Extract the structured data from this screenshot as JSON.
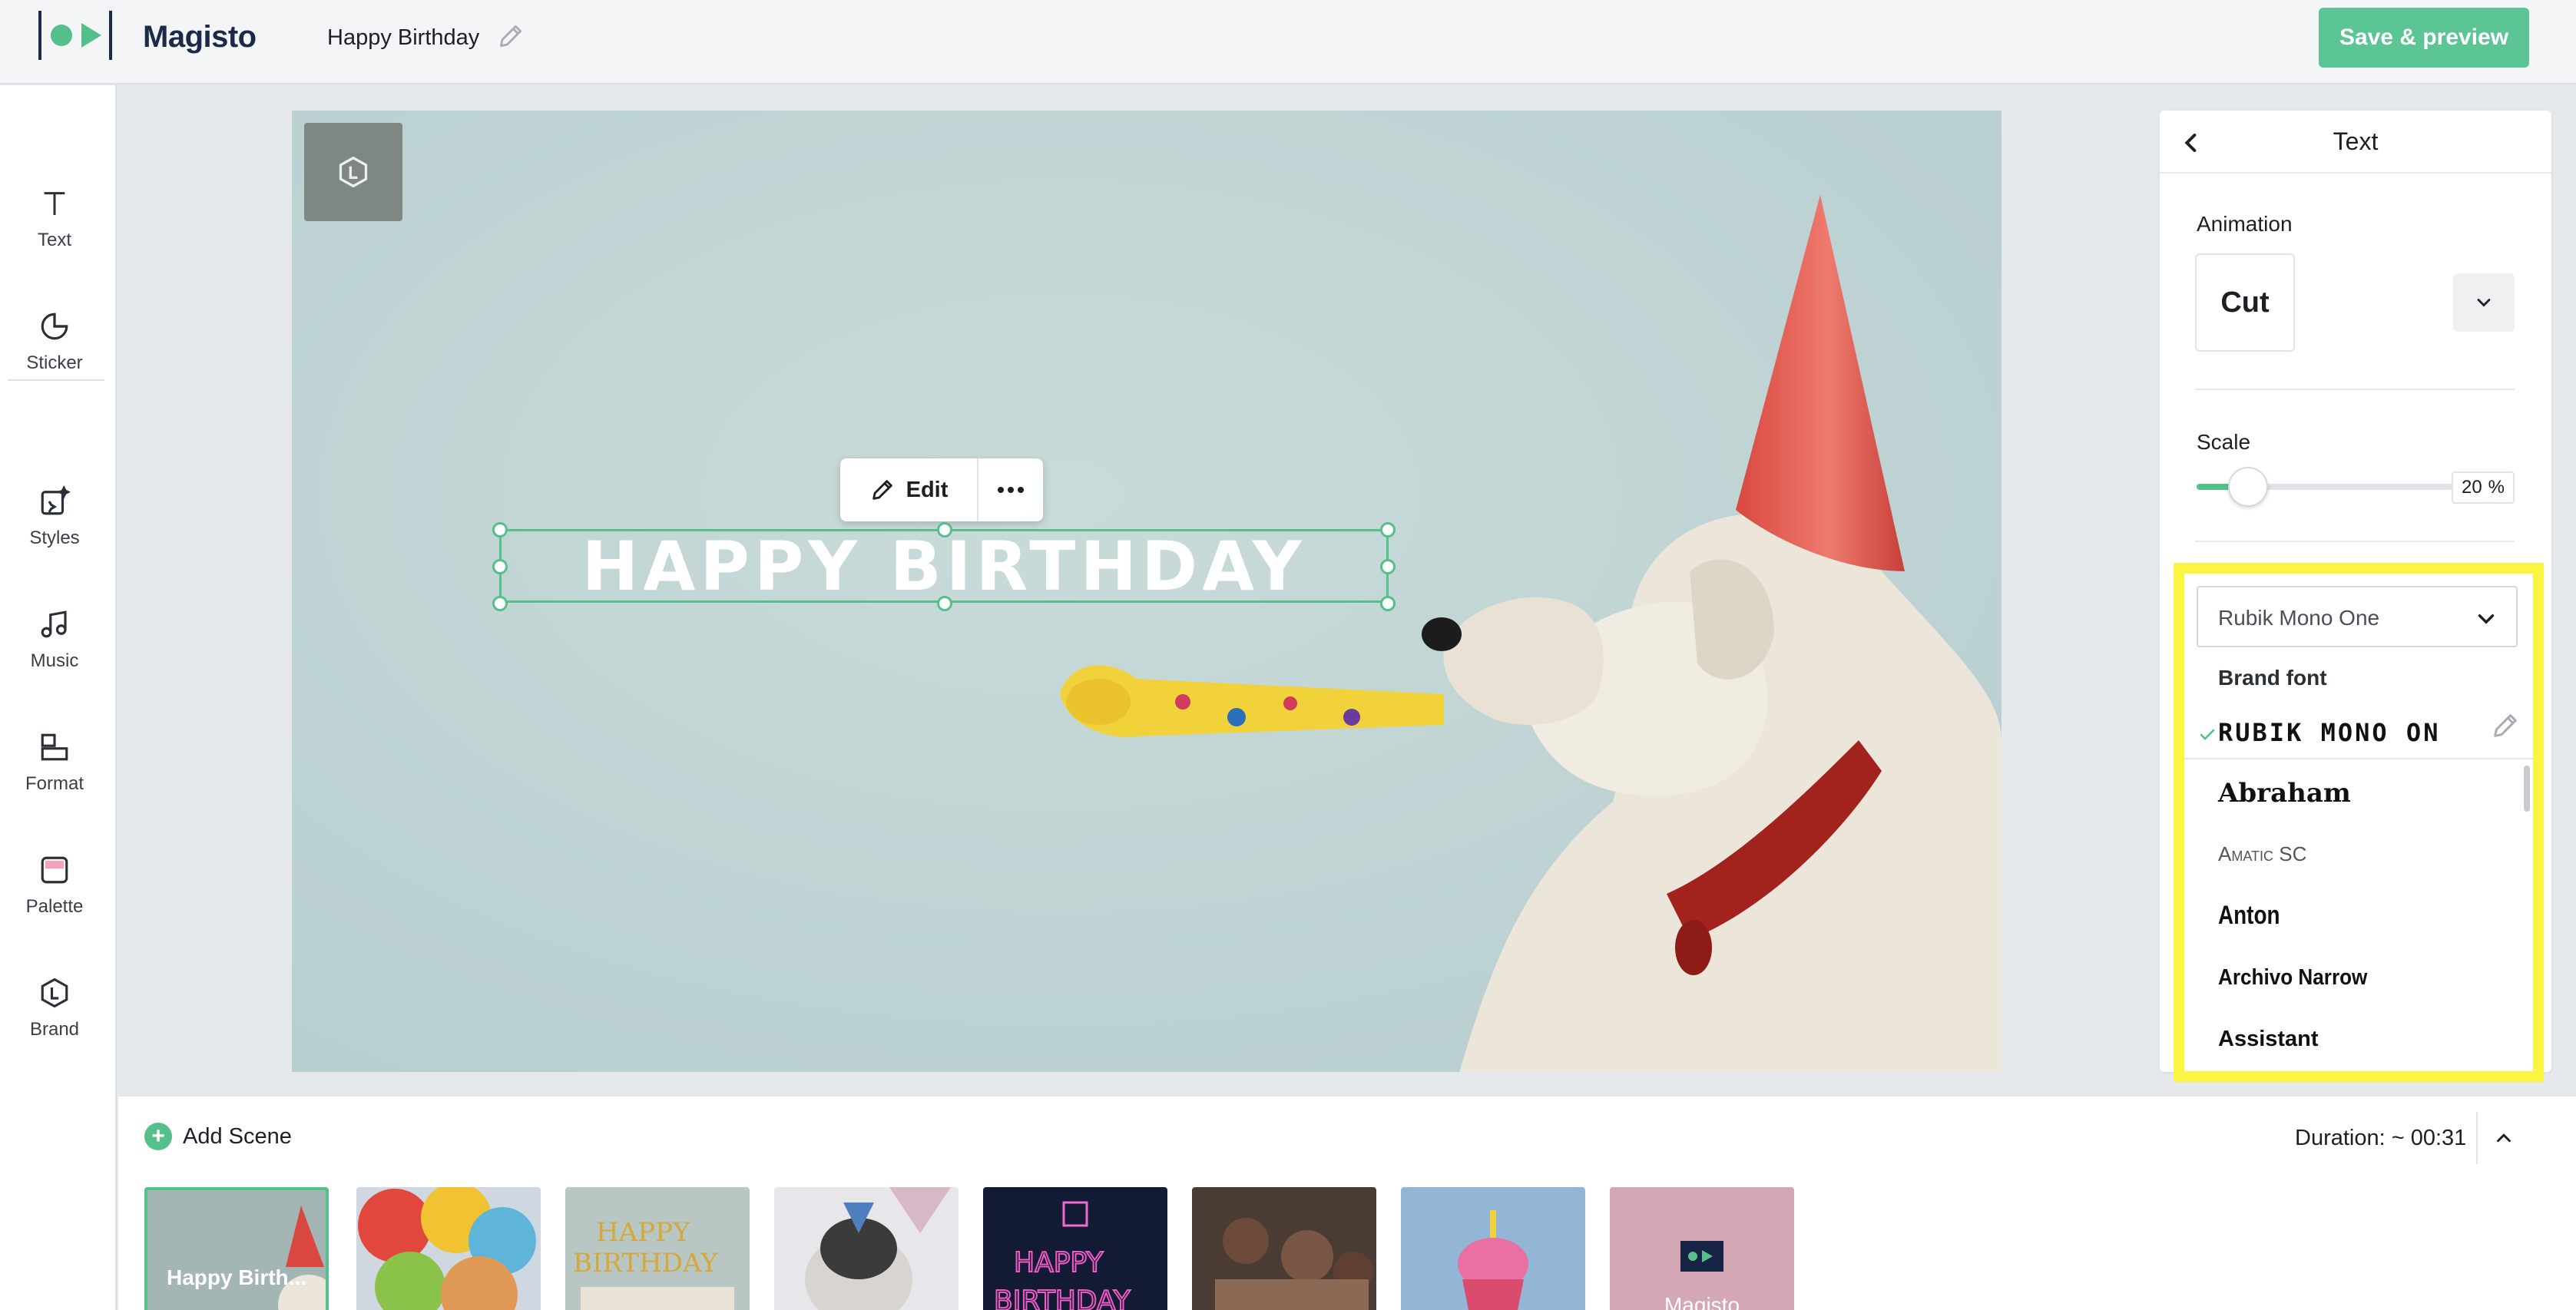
{
  "app": {
    "brand": "Magisto",
    "project_title": "Happy Birthday",
    "save_button": "Save & preview"
  },
  "toolbar": {
    "items": [
      {
        "label": "Text",
        "icon": "text-icon"
      },
      {
        "label": "Sticker",
        "icon": "sticker-icon"
      },
      {
        "label": "Styles",
        "icon": "styles-icon"
      },
      {
        "label": "Music",
        "icon": "music-icon"
      },
      {
        "label": "Format",
        "icon": "format-icon"
      },
      {
        "label": "Palette",
        "icon": "palette-icon"
      },
      {
        "label": "Brand",
        "icon": "brand-icon"
      }
    ]
  },
  "canvas": {
    "headline": "HAPPY BIRTHDAY",
    "edit_label": "Edit"
  },
  "panel": {
    "title": "Text",
    "animation_label": "Animation",
    "animation_value": "Cut",
    "scale_label": "Scale",
    "scale_value": "20",
    "scale_unit": "%",
    "scale_fraction": 0.2,
    "font_selected": "Rubik Mono One",
    "font_group": "Brand font",
    "fonts": [
      {
        "label": "RUBIK MONO ON",
        "selected": true
      },
      {
        "label": "Abraham"
      },
      {
        "label": "Amatic SC"
      },
      {
        "label": "Anton"
      },
      {
        "label": "Archivo Narrow"
      },
      {
        "label": "Assistant"
      }
    ]
  },
  "scenes": {
    "add_label": "Add Scene",
    "duration": "Duration: ~ 00:31",
    "thumbnails": [
      {
        "caption": "Happy Birth...",
        "active": true
      },
      {
        "caption": ""
      },
      {
        "caption": ""
      },
      {
        "caption": ""
      },
      {
        "caption": ""
      },
      {
        "caption": ""
      },
      {
        "caption": ""
      },
      {
        "caption": "Magisto"
      }
    ]
  },
  "colors": {
    "accent": "#56c08a",
    "highlight": "#fbf542",
    "canvas_bg": "#c2d5d3"
  }
}
